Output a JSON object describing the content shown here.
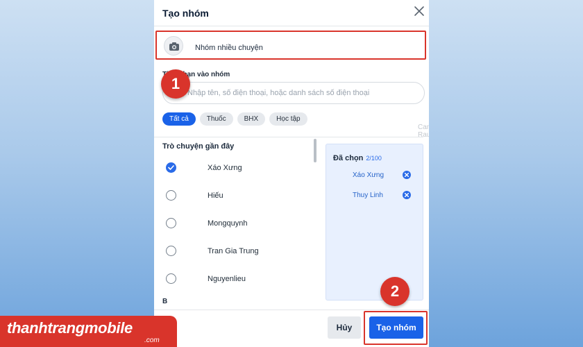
{
  "dialog": {
    "title": "Tạo nhóm",
    "group_name": "Nhóm nhiều chuyện",
    "add_label": "Thêm bạn vào nhóm",
    "search_placeholder": "Nhập tên, số điện thoại, hoặc danh sách số điện thoại",
    "filters": [
      "Tất cả",
      "Thuốc",
      "BHX",
      "Học tập"
    ],
    "active_filter": "Tất cả",
    "watermark": "Canh Rau",
    "recent_title": "Trò chuyện gần đây",
    "contacts": [
      {
        "name": "Xáo Xưng",
        "checked": true
      },
      {
        "name": "Hiếu",
        "checked": false
      },
      {
        "name": "Mongquynh",
        "checked": false
      },
      {
        "name": "Tran Gia Trung",
        "checked": false
      },
      {
        "name": "Nguyenlieu",
        "checked": false
      }
    ],
    "section_letter": "B",
    "selected": {
      "label": "Đã chọn",
      "count": "2/100",
      "items": [
        "Xáo Xưng",
        "Thuy Linh"
      ]
    },
    "cancel_label": "Hủy",
    "create_label": "Tạo nhóm"
  },
  "annotations": {
    "step1": "1",
    "step2": "2"
  },
  "logo": {
    "main": "thanhtrangmobile",
    "sub": ".com"
  },
  "colors": {
    "accent": "#1a62e8",
    "annotation_red": "#d9342b"
  }
}
